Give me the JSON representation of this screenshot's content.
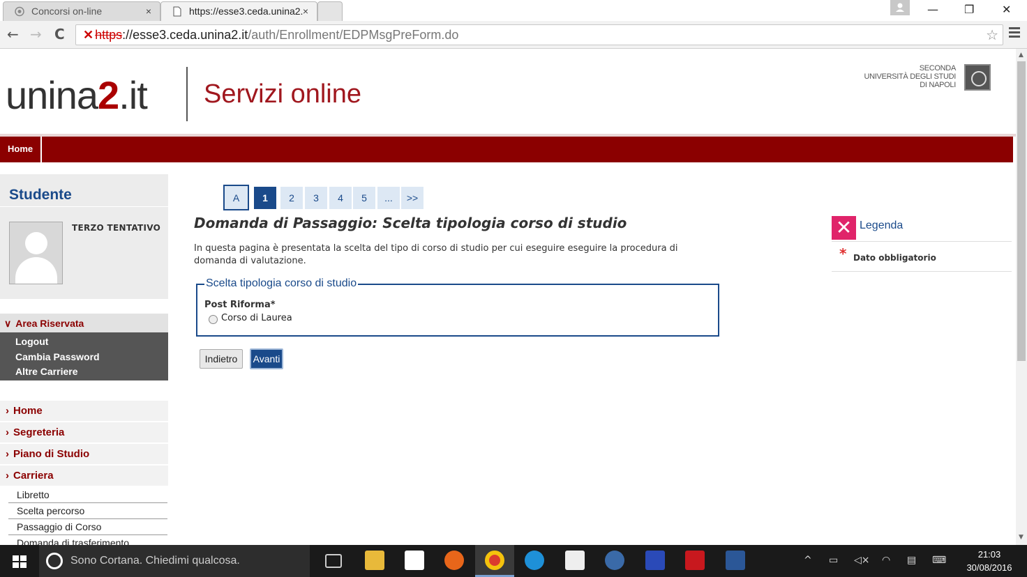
{
  "browser": {
    "tabs": [
      {
        "title": "Concorsi on-line",
        "active": false
      },
      {
        "title": "https://esse3.ceda.unina2.",
        "active": true
      }
    ],
    "close_glyph": "×",
    "url": {
      "scheme": "https",
      "rest_host": "://esse3.ceda.unina2.it",
      "path": "/auth/Enrollment/EDPMsgPreForm.do"
    },
    "nav": {
      "back": "←",
      "forward": "→",
      "reload": "C",
      "star": "☆"
    },
    "window": {
      "minimize": "—",
      "restore": "❐",
      "close": "✕"
    }
  },
  "site": {
    "logo_pre": "unina",
    "logo_num": "2",
    "logo_post": ".it",
    "subtitle": "Servizi online",
    "university": [
      "SECONDA",
      "UNIVERSITÀ DEGLI STUDI",
      "DI NAPOLI"
    ]
  },
  "navbar": {
    "home": "Home"
  },
  "sidebar": {
    "title": "Studente",
    "student_name": "TERZO TENTATIVO",
    "area": {
      "label": "Area Riservata",
      "items": [
        "Logout",
        "Cambia Password",
        "Altre Carriere"
      ]
    },
    "menu": [
      "Home",
      "Segreteria",
      "Piano di Studio",
      "Carriera"
    ],
    "submenu": [
      "Libretto",
      "Scelta percorso",
      "Passaggio di Corso",
      "Domanda di trasferimento"
    ]
  },
  "pager": {
    "items": [
      "A",
      "1",
      "2",
      "3",
      "4",
      "5",
      "...",
      ">>"
    ],
    "current": "1"
  },
  "main": {
    "title": "Domanda di Passaggio: Scelta tipologia corso di studio",
    "intro": "In questa pagina è presentata la scelta del tipo di corso di studio per cui eseguire eseguire la procedura di domanda di valutazione.",
    "fieldset_legend": "Scelta tipologia corso di studio",
    "field_label": "Post Riforma*",
    "option": "Corso di Laurea",
    "back_button": "Indietro",
    "next_button": "Avanti"
  },
  "legend": {
    "title": "Legenda",
    "star": "*",
    "required": "Dato obbligatorio"
  },
  "taskbar": {
    "cortana": "Sono Cortana. Chiedimi qualcosa.",
    "time": "21:03",
    "date": "30/08/2016"
  },
  "colors": {
    "brand_red": "#8b0000",
    "brand_blue": "#1a4a8a",
    "legend_pink": "#e0246a"
  }
}
